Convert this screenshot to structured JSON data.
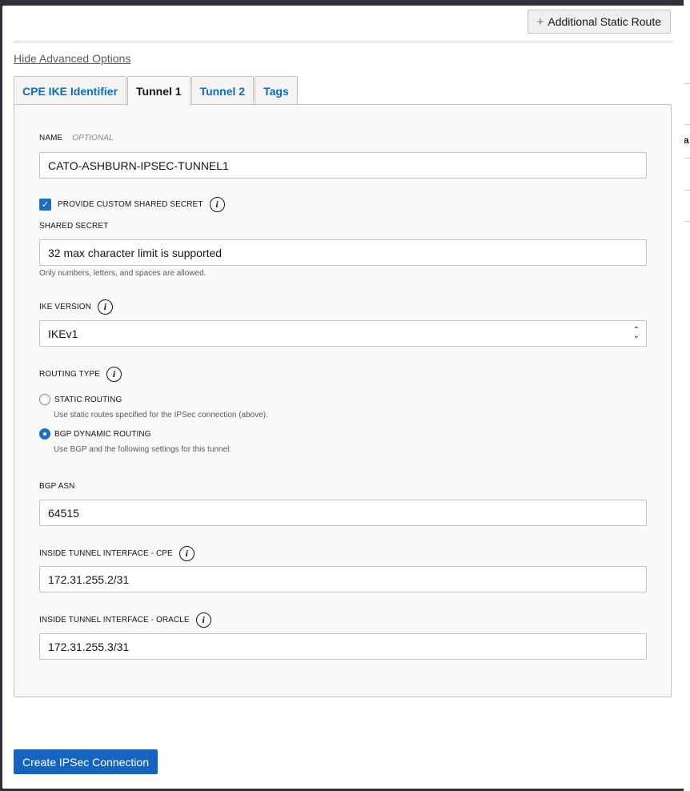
{
  "top": {
    "additional_route_icon": "plus-icon",
    "additional_route_label": "Additional Static Route"
  },
  "advanced_toggle": "Hide Advanced Options",
  "tabs": [
    {
      "label": "CPE IKE Identifier",
      "active": false
    },
    {
      "label": "Tunnel 1",
      "active": true
    },
    {
      "label": "Tunnel 2",
      "active": false
    },
    {
      "label": "Tags",
      "active": false
    }
  ],
  "form": {
    "name": {
      "label": "NAME",
      "optional": "OPTIONAL",
      "value": "CATO-ASHBURN-IPSEC-TUNNEL1"
    },
    "custom_secret": {
      "label": "PROVIDE CUSTOM SHARED SECRET",
      "checked": true
    },
    "shared_secret": {
      "label": "SHARED SECRET",
      "value": "32 max character limit is supported",
      "hint": "Only numbers, letters, and spaces are allowed."
    },
    "ike_version": {
      "label": "IKE VERSION",
      "value": "IKEv1"
    },
    "routing_type": {
      "label": "ROUTING TYPE",
      "options": [
        {
          "label": "STATIC ROUTING",
          "desc": "Use static routes specified for the IPSec connection (above).",
          "selected": false
        },
        {
          "label": "BGP DYNAMIC ROUTING",
          "desc": "Use BGP and the following settings for this tunnel:",
          "selected": true
        }
      ]
    },
    "bgp_asn": {
      "label": "BGP ASN",
      "value": "64515"
    },
    "cpe_interface": {
      "label": "INSIDE TUNNEL INTERFACE - CPE",
      "value": "172.31.255.2/31"
    },
    "oracle_interface": {
      "label": "INSIDE TUNNEL INTERFACE - ORACLE",
      "value": "172.31.255.3/31"
    }
  },
  "footer": {
    "create_label": "Create IPSec Connection"
  },
  "backdrop": {
    "peek_char": "a"
  },
  "colors": {
    "accent": "#1565c0",
    "tab_link": "#0f6cbd",
    "panel_bg": "#fbf9f8"
  }
}
